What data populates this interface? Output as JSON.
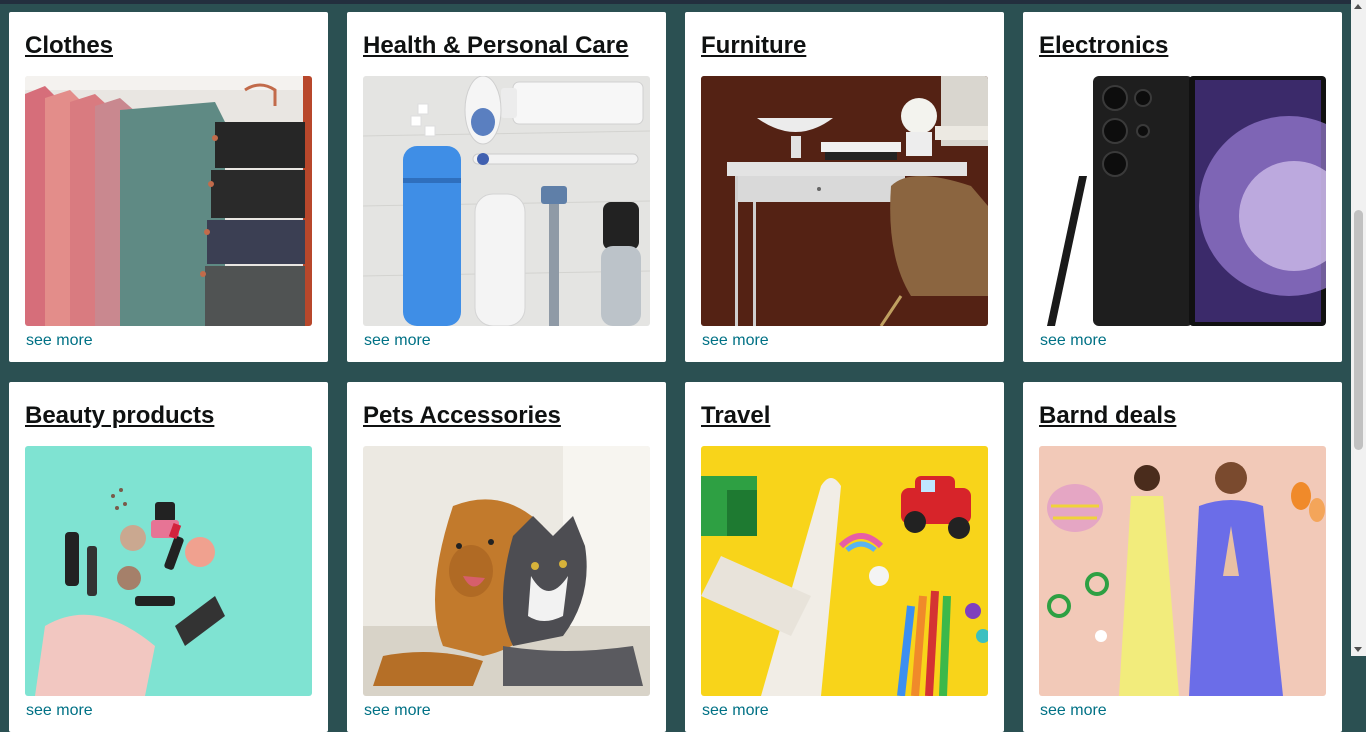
{
  "cards": [
    {
      "title": "Clothes",
      "link": "see more",
      "image": "clothes-on-hangers"
    },
    {
      "title": "Health & Personal Care",
      "link": "see more",
      "image": "toiletries-flatlay"
    },
    {
      "title": "Furniture",
      "link": "see more",
      "image": "desk-and-chair"
    },
    {
      "title": "Electronics",
      "link": "see more",
      "image": "smartphone-with-stylus"
    },
    {
      "title": "Beauty products",
      "link": "see more",
      "image": "makeup-spilling-from-bag"
    },
    {
      "title": "Pets Accessories",
      "link": "see more",
      "image": "dog-and-cat"
    },
    {
      "title": "Travel",
      "link": "see more",
      "image": "toy-airplane-and-car"
    },
    {
      "title": "Barnd deals",
      "link": "see more",
      "image": "fashion-models"
    }
  ],
  "colors": {
    "page_background": "#2b5052",
    "link": "#007185",
    "title": "#0f1111"
  }
}
